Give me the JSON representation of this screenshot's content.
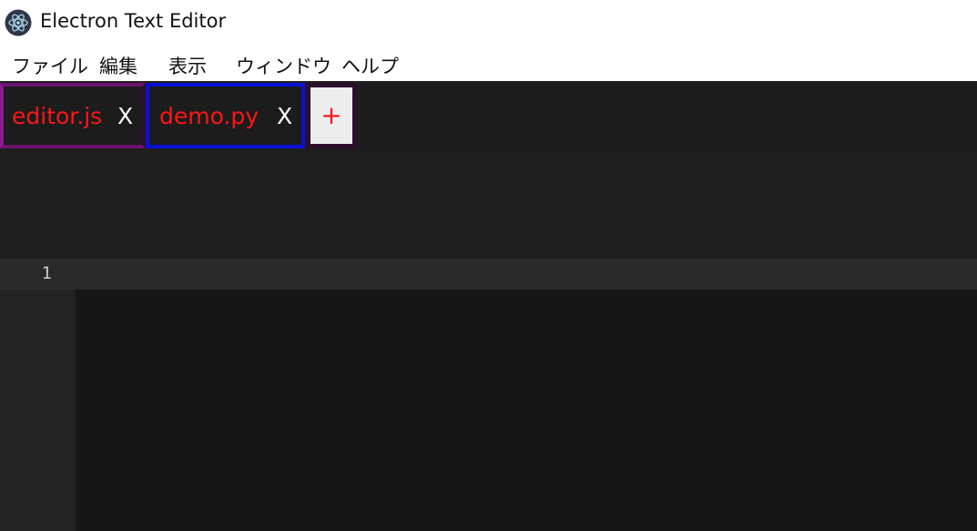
{
  "window": {
    "title": "Electron Text Editor",
    "icon": "electron-atom-icon"
  },
  "menu": {
    "items": [
      {
        "label": "ファイル"
      },
      {
        "label": "編集"
      },
      {
        "label": "表示"
      },
      {
        "label": "ウィンドウ"
      },
      {
        "label": "ヘルプ"
      }
    ]
  },
  "tabs": {
    "items": [
      {
        "name": "editor.js",
        "close": "X",
        "active": false
      },
      {
        "name": "demo.py",
        "close": "X",
        "active": true
      }
    ],
    "add_label": "+"
  },
  "editor": {
    "line_numbers": [
      "1"
    ],
    "content": ""
  },
  "colors": {
    "tab_text": "#ff1616",
    "active_tab_border": "#0b10d6",
    "inactive_tab_border": "#6a146f",
    "editor_bg": "#161616"
  }
}
